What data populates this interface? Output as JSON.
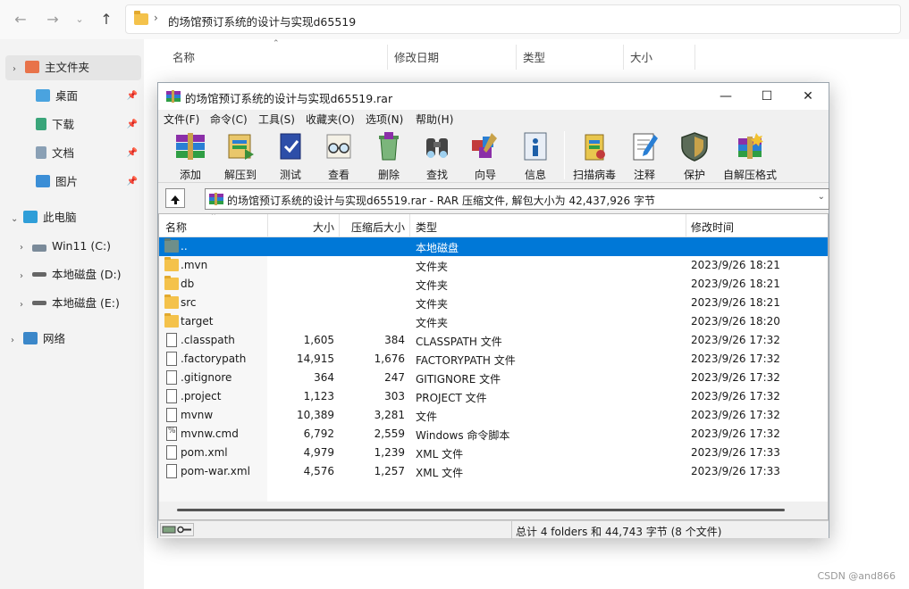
{
  "explorer": {
    "address": {
      "path": "的场馆预订系统的设计与实现d65519",
      "separator": "›"
    },
    "sidebar": [
      {
        "label": "主文件夹",
        "icon": "home-icon",
        "pinned": false,
        "selected": true
      },
      {
        "label": "桌面",
        "icon": "desktop-icon",
        "pinned": true
      },
      {
        "label": "下载",
        "icon": "download-icon",
        "pinned": true
      },
      {
        "label": "文档",
        "icon": "document-icon",
        "pinned": true
      },
      {
        "label": "图片",
        "icon": "picture-icon",
        "pinned": true
      },
      {
        "label": "此电脑",
        "icon": "computer-icon"
      },
      {
        "label": "Win11 (C:)",
        "icon": "windows-drive-icon"
      },
      {
        "label": "本地磁盘 (D:)",
        "icon": "drive-icon"
      },
      {
        "label": "本地磁盘 (E:)",
        "icon": "drive-icon"
      },
      {
        "label": "网络",
        "icon": "network-icon"
      }
    ],
    "columns": [
      "名称",
      "修改日期",
      "类型",
      "大小"
    ],
    "watermark": "CSDN @and866"
  },
  "winrar": {
    "title": "的场馆预订系统的设计与实现d65519.rar",
    "window_controls": {
      "minimize": "—",
      "maximize": "☐",
      "close": "✕"
    },
    "menu": [
      "文件(F)",
      "命令(C)",
      "工具(S)",
      "收藏夹(O)",
      "选项(N)",
      "帮助(H)"
    ],
    "toolbar": [
      {
        "label": "添加",
        "icon": "add-books-icon"
      },
      {
        "label": "解压到",
        "icon": "extract-to-icon"
      },
      {
        "label": "测试",
        "icon": "test-icon"
      },
      {
        "label": "查看",
        "icon": "view-glasses-icon"
      },
      {
        "label": "删除",
        "icon": "delete-recycle-icon"
      },
      {
        "label": "查找",
        "icon": "find-binoculars-icon"
      },
      {
        "label": "向导",
        "icon": "wizard-icon"
      },
      {
        "label": "信息",
        "icon": "info-icon"
      },
      {
        "label": "扫描病毒",
        "icon": "virus-scan-icon"
      },
      {
        "label": "注释",
        "icon": "comment-icon"
      },
      {
        "label": "保护",
        "icon": "protect-shield-icon"
      },
      {
        "label": "自解压格式",
        "icon": "sfx-icon"
      }
    ],
    "path_text": "的场馆预订系统的设计与实现d65519.rar - RAR 压缩文件, 解包大小为 42,437,926 字节",
    "columns": {
      "name": "名称",
      "size": "大小",
      "packed": "压缩后大小",
      "type": "类型",
      "modified": "修改时间"
    },
    "rows": [
      {
        "name": "..",
        "size": "",
        "packed": "",
        "type": "本地磁盘",
        "modified": "",
        "kind": "parent",
        "selected": true
      },
      {
        "name": ".mvn",
        "size": "",
        "packed": "",
        "type": "文件夹",
        "modified": "2023/9/26 18:21",
        "kind": "folder"
      },
      {
        "name": "db",
        "size": "",
        "packed": "",
        "type": "文件夹",
        "modified": "2023/9/26 18:21",
        "kind": "folder"
      },
      {
        "name": "src",
        "size": "",
        "packed": "",
        "type": "文件夹",
        "modified": "2023/9/26 18:21",
        "kind": "folder"
      },
      {
        "name": "target",
        "size": "",
        "packed": "",
        "type": "文件夹",
        "modified": "2023/9/26 18:20",
        "kind": "folder"
      },
      {
        "name": ".classpath",
        "size": "1,605",
        "packed": "384",
        "type": "CLASSPATH 文件",
        "modified": "2023/9/26 17:32",
        "kind": "file"
      },
      {
        "name": ".factorypath",
        "size": "14,915",
        "packed": "1,676",
        "type": "FACTORYPATH 文件",
        "modified": "2023/9/26 17:32",
        "kind": "file"
      },
      {
        "name": ".gitignore",
        "size": "364",
        "packed": "247",
        "type": "GITIGNORE 文件",
        "modified": "2023/9/26 17:32",
        "kind": "file"
      },
      {
        "name": ".project",
        "size": "1,123",
        "packed": "303",
        "type": "PROJECT 文件",
        "modified": "2023/9/26 17:32",
        "kind": "file"
      },
      {
        "name": "mvnw",
        "size": "10,389",
        "packed": "3,281",
        "type": "文件",
        "modified": "2023/9/26 17:32",
        "kind": "file"
      },
      {
        "name": "mvnw.cmd",
        "size": "6,792",
        "packed": "2,559",
        "type": "Windows 命令脚本",
        "modified": "2023/9/26 17:32",
        "kind": "cmd"
      },
      {
        "name": "pom.xml",
        "size": "4,979",
        "packed": "1,239",
        "type": "XML 文件",
        "modified": "2023/9/26 17:33",
        "kind": "file"
      },
      {
        "name": "pom-war.xml",
        "size": "4,576",
        "packed": "1,257",
        "type": "XML 文件",
        "modified": "2023/9/26 17:33",
        "kind": "file"
      }
    ],
    "status": "总计 4 folders 和 44,743 字节 (8 个文件)",
    "colors": {
      "selection": "#0078d7",
      "folder": "#f4c24b"
    }
  }
}
